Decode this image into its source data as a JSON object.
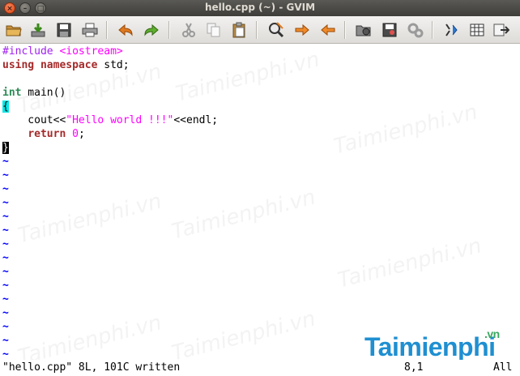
{
  "window": {
    "title": "hello.cpp (~) - GVIM"
  },
  "toolbar": {
    "icons": [
      "open-icon",
      "save-icon",
      "save-all-icon",
      "print-icon",
      "undo-icon",
      "redo-icon",
      "cut-icon",
      "copy-icon",
      "paste-icon",
      "find-replace-icon",
      "find-next-icon",
      "find-prev-icon",
      "load-session-icon",
      "save-session-icon",
      "run-script-icon",
      "make-icon",
      "shell-icon",
      "tags-icon",
      "help-icon"
    ]
  },
  "editor": {
    "lines": [
      {
        "t1": "#include ",
        "t2": "<iostream>"
      },
      {
        "t1": "using",
        "t2": " ",
        "t3": "namespace",
        "t4": " std;"
      },
      {
        "t1": ""
      },
      {
        "t1": "int",
        "t2": " main()"
      },
      {
        "t1": "{"
      },
      {
        "t1": "    cout<<",
        "t2": "\"Hello world !!!\"",
        "t3": "<<endl;"
      },
      {
        "t1": "    ",
        "t2": "return",
        "t3": " ",
        "t4": "0",
        "t5": ";"
      },
      {
        "t1": "}"
      }
    ],
    "tilde": "~"
  },
  "status": {
    "message": "\"hello.cpp\" 8L, 101C written",
    "position": "8,1",
    "scroll": "All"
  },
  "watermark": {
    "text": "Taimienphi.vn",
    "logo_main": "Taimienphi",
    "logo_suffix": ".vn"
  },
  "colors": {
    "preprocessor": "#a020f0",
    "keyword": "#a52a2a",
    "type": "#2e8b57",
    "string": "#ff00ff",
    "tilde": "#0000ff",
    "bracket_match": "#00e8e8"
  }
}
